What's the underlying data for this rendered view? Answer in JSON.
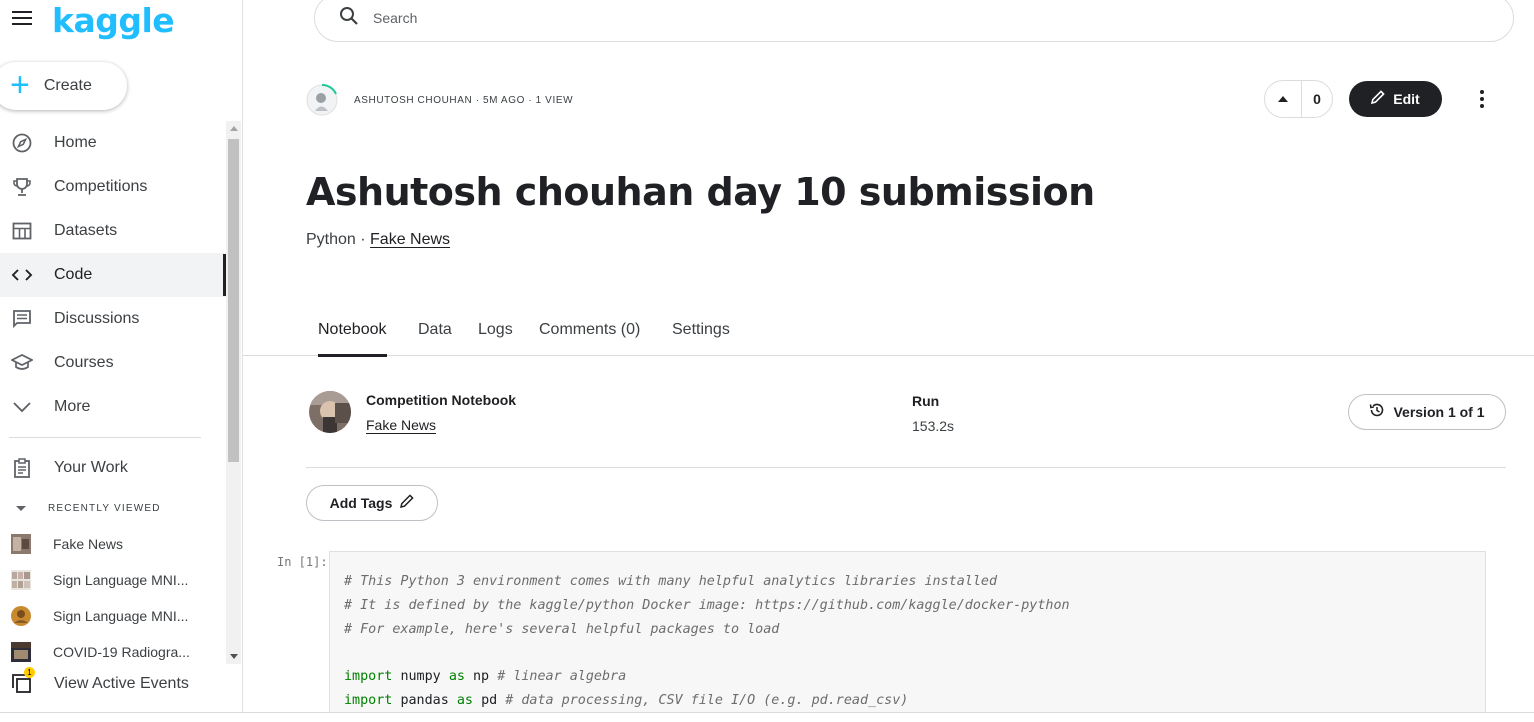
{
  "sidebar": {
    "logo": "kaggle",
    "create_label": "Create",
    "nav": [
      {
        "label": "Home",
        "icon": "compass-icon"
      },
      {
        "label": "Competitions",
        "icon": "trophy-icon"
      },
      {
        "label": "Datasets",
        "icon": "table-icon"
      },
      {
        "label": "Code",
        "icon": "code-icon",
        "active": true
      },
      {
        "label": "Discussions",
        "icon": "comments-icon"
      },
      {
        "label": "Courses",
        "icon": "school-icon"
      },
      {
        "label": "More",
        "icon": "chevron-down-icon"
      }
    ],
    "your_work": "Your Work",
    "recently_viewed_title": "RECENTLY VIEWED",
    "recent": [
      {
        "label": "Fake News"
      },
      {
        "label": "Sign Language MNI..."
      },
      {
        "label": "Sign Language MNI..."
      },
      {
        "label": "COVID-19 Radiogra..."
      }
    ],
    "active_events": "View Active Events",
    "active_events_badge": "1"
  },
  "search": {
    "placeholder": "Search"
  },
  "header": {
    "author_meta": "ASHUTOSH CHOUHAN · 5M AGO · 1 VIEW",
    "vote_count": "0",
    "edit_label": "Edit"
  },
  "notebook": {
    "title": "Ashutosh chouhan day 10 submission",
    "language": "Python",
    "separator": " · ",
    "competition": "Fake News"
  },
  "tabs": [
    {
      "label": "Notebook",
      "active": true
    },
    {
      "label": "Data"
    },
    {
      "label": "Logs"
    },
    {
      "label": "Comments (0)"
    },
    {
      "label": "Settings"
    }
  ],
  "info": {
    "kind": "Competition Notebook",
    "competition": "Fake News",
    "run_label": "Run",
    "run_value": "153.2s",
    "version_label": "Version 1 of 1"
  },
  "tags": {
    "label": "Add Tags"
  },
  "cell": {
    "prompt": "In [1]:",
    "lines": [
      "# This Python 3 environment comes with many helpful analytics libraries installed",
      "# It is defined by the kaggle/python Docker image: https://github.com/kaggle/docker-python",
      "# For example, here's several helpful packages to load",
      "",
      "import numpy as np # linear algebra",
      "import pandas as pd # data processing, CSV file I/O (e.g. pd.read_csv)"
    ]
  },
  "colors": {
    "brand": "#20beff",
    "dark": "#202124",
    "badge": "#ffcc00"
  }
}
